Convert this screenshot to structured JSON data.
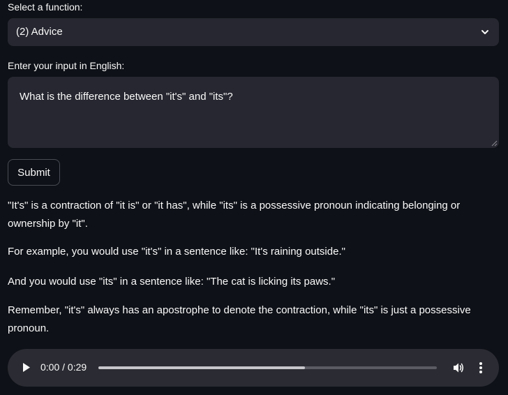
{
  "select": {
    "label": "Select a function:",
    "value": "(2) Advice"
  },
  "input": {
    "label": "Enter your input in English:",
    "value": "What is the difference between \"it's\" and \"its\"?"
  },
  "submit_label": "Submit",
  "response": [
    "\"It's\" is a contraction of \"it is\" or \"it has\", while \"its\" is a possessive pronoun indicating belonging or ownership by \"it\".",
    "For example, you would use \"it's\" in a sentence like: \"It's raining outside.\"",
    "And you would use \"its\" in a sentence like: \"The cat is licking its paws.\"",
    "Remember, \"it's\" always has an apostrophe to denote the contraction, while \"its\" is just a possessive pronoun."
  ],
  "audio": {
    "time": "0:00 / 0:29",
    "progress_fraction": 0.61
  },
  "colors": {
    "background": "#0e1117",
    "widget": "#262730",
    "text": "#fafafa"
  }
}
